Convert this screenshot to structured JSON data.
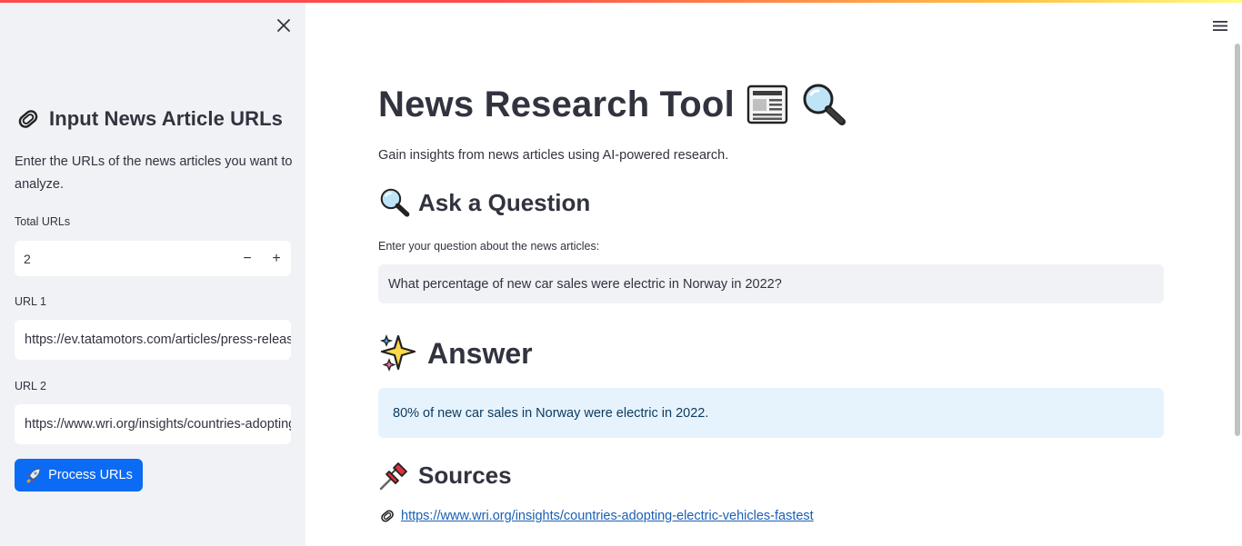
{
  "sidebar": {
    "header_icon": "paperclip-icon",
    "title": "Input News Article URLs",
    "description": "Enter the URLs of the news articles you want to analyze.",
    "total_urls_label": "Total URLs",
    "total_urls_value": "2",
    "decrement_symbol": "−",
    "increment_symbol": "+",
    "url1_label": "URL 1",
    "url1_value": "https://ev.tatamotors.com/articles/press-release",
    "url2_label": "URL 2",
    "url2_value": "https://www.wri.org/insights/countries-adopting-electric-vehicles-fastest",
    "process_button_icon": "rocket-icon",
    "process_button_label": "Process URLs"
  },
  "main": {
    "title": "News Research Tool",
    "title_icons": [
      "newspaper-icon",
      "magnifier-icon"
    ],
    "subtitle": "Gain insights from news articles using AI-powered research.",
    "ask_heading": "Ask a Question",
    "question_label": "Enter your question about the news articles:",
    "question_value": "What percentage of new car sales were electric in Norway in 2022?",
    "answer_heading": "Answer",
    "answer_text": "80% of new car sales in Norway were electric in 2022.",
    "sources_heading": "Sources",
    "source_link": "https://www.wri.org/insights/countries-adopting-electric-vehicles-fastest"
  },
  "colors": {
    "sidebar_bg": "#f0f2f6",
    "primary_button": "#0b6bf5",
    "answer_bg": "#e6f3fd",
    "answer_text": "#0d3c61",
    "link": "#1a5fb4"
  }
}
